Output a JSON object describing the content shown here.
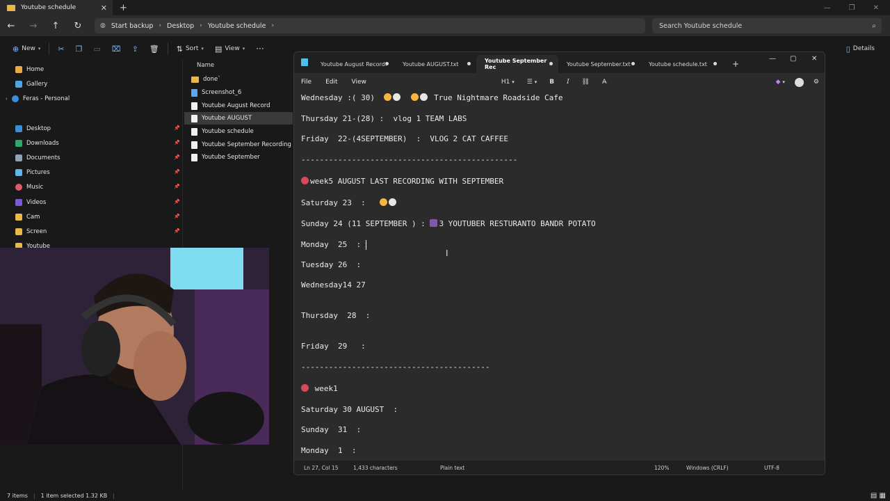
{
  "explorer": {
    "tab_title": "Youtube schedule",
    "breadcrumbs": [
      "Start backup",
      "Desktop",
      "Youtube schedule"
    ],
    "search_placeholder": "Search Youtube schedule",
    "toolbar": {
      "new": "New",
      "sort": "Sort",
      "view": "View",
      "details": "Details"
    },
    "sidebar": {
      "home": "Home",
      "gallery": "Gallery",
      "personal": "Feras - Personal",
      "quick": [
        "Desktop",
        "Downloads",
        "Documents",
        "Pictures",
        "Music",
        "Videos",
        "Cam",
        "Screen",
        "Youtube"
      ]
    },
    "column_name": "Name",
    "files": [
      "done`",
      "Screenshot_6",
      "Youtube August Record",
      "Youtube AUGUST",
      "Youtube schedule",
      "Youtube September Recording",
      "Youtube September"
    ],
    "status": {
      "items": "7 items",
      "selected": "1 item selected  1.32 KB"
    }
  },
  "notepad": {
    "tabs": [
      "Youtube August Record.",
      "Youtube AUGUST.txt",
      "Youtube September Rec",
      "Youtube September.txt",
      "Youtube schedule.txt"
    ],
    "menu": [
      "File",
      "Edit",
      "View"
    ],
    "heading_format": "H1",
    "lines": {
      "l1": ":( 30)  ",
      "l1a": "Wednesday ",
      "l1b": " True Nightmare Roadside Cafe",
      "l2": "Thursday 21-(28) :  vlog 1 TEAM LABS",
      "l3": "Friday  22-(4SEPTEMBER)  :  VLOG 2 CAT CAFFEE",
      "l4": "-----------------------------------------------",
      "l5": "week5 AUGUST LAST RECORDING WITH SEPTEMBER",
      "l6": "Saturday 23  :   ",
      "l7a": "Sunday 24 (11 SEPTEMBER ) : ",
      "l7b": "3 YOUTUBER RESTURANTO BANDR POTATO",
      "l8": "Monday  25  : ",
      "l9": "Tuesday 26  :",
      "l10": "Wednesday14 27",
      "l11": "Thursday  28  :",
      "l12": "Friday  29   :",
      "l13": "-----------------------------------------",
      "l14": " week1",
      "l15": "Saturday 30 AUGUST  :",
      "l16": "Sunday  31  :",
      "l17": "Monday  1  :"
    },
    "status": {
      "position": "Ln 27, Col 15",
      "chars": "1,433 characters",
      "type": "Plain text",
      "zoom": "120%",
      "eol": "Windows (CRLF)",
      "encoding": "UTF-8"
    }
  }
}
